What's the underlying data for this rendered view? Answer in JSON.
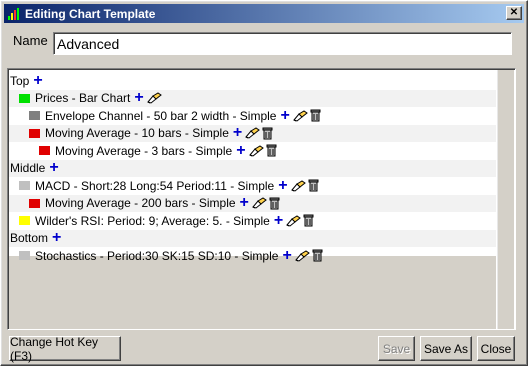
{
  "window": {
    "title": "Editing Chart Template"
  },
  "name_field": {
    "label": "Name",
    "value": "Advanced"
  },
  "tree": {
    "rows": [
      {
        "type": "section",
        "label": "Top"
      },
      {
        "type": "item",
        "label": "Prices - Bar Chart",
        "color": "#00e000",
        "depth": 1,
        "trash": false
      },
      {
        "type": "item",
        "label": "Envelope Channel - 50 bar 2 width - Simple",
        "color": "#808080",
        "depth": 2,
        "trash": true
      },
      {
        "type": "item",
        "label": "Moving Average - 10 bars - Simple",
        "color": "#e00000",
        "depth": 2,
        "trash": true
      },
      {
        "type": "item",
        "label": "Moving Average - 3 bars - Simple",
        "color": "#e00000",
        "depth": 3,
        "trash": true
      },
      {
        "type": "section",
        "label": "Middle"
      },
      {
        "type": "item",
        "label": "MACD -  Short:28 Long:54 Period:11 - Simple",
        "color": "#c0c0c0",
        "depth": 1,
        "trash": true
      },
      {
        "type": "item",
        "label": "Moving Average - 200 bars - Simple",
        "color": "#e00000",
        "depth": 2,
        "trash": true
      },
      {
        "type": "item",
        "label": "Wilder's RSI: Period: 9; Average: 5. - Simple",
        "color": "#ffff00",
        "depth": 1,
        "trash": true
      },
      {
        "type": "section",
        "label": "Bottom"
      },
      {
        "type": "item",
        "label": "Stochastics -  Period:30 SK:15 SD:10 - Simple",
        "color": "#c0c0c0",
        "depth": 1,
        "trash": true
      }
    ]
  },
  "buttons": {
    "hotkey": "Change Hot Key (F3)",
    "save": "Save",
    "save_as": "Save As",
    "close": "Close"
  },
  "icons": {
    "add": "plus-icon",
    "edit": "edit-pencil-icon",
    "delete": "trash-icon"
  }
}
